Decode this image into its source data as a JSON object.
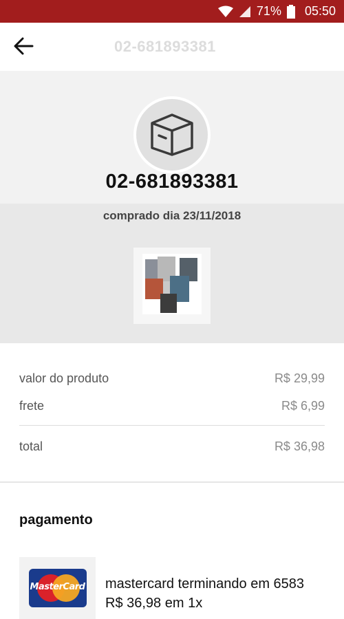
{
  "status_bar": {
    "battery": "71%",
    "time": "05:50",
    "icons": [
      "wifi-icon",
      "signal-icon",
      "battery-icon"
    ],
    "background": "#a21d1d"
  },
  "app_bar": {
    "back_icon": "arrow-left-icon",
    "title": "02-681893381"
  },
  "order": {
    "icon": "package-box-icon",
    "number": "02-681893381",
    "purchase_date": "comprado dia 23/11/2018",
    "product_image": "book-collection-thumbnail"
  },
  "summary": {
    "rows": [
      {
        "label": "valor do produto",
        "value": "R$ 29,99"
      },
      {
        "label": "frete",
        "value": "R$ 6,99"
      }
    ],
    "total": {
      "label": "total",
      "value": "R$ 36,98"
    }
  },
  "payment": {
    "title": "pagamento",
    "card_brand": "MasterCard",
    "card_line": "mastercard terminando em 6583",
    "amount_line": "R$ 36,98 em 1x"
  }
}
